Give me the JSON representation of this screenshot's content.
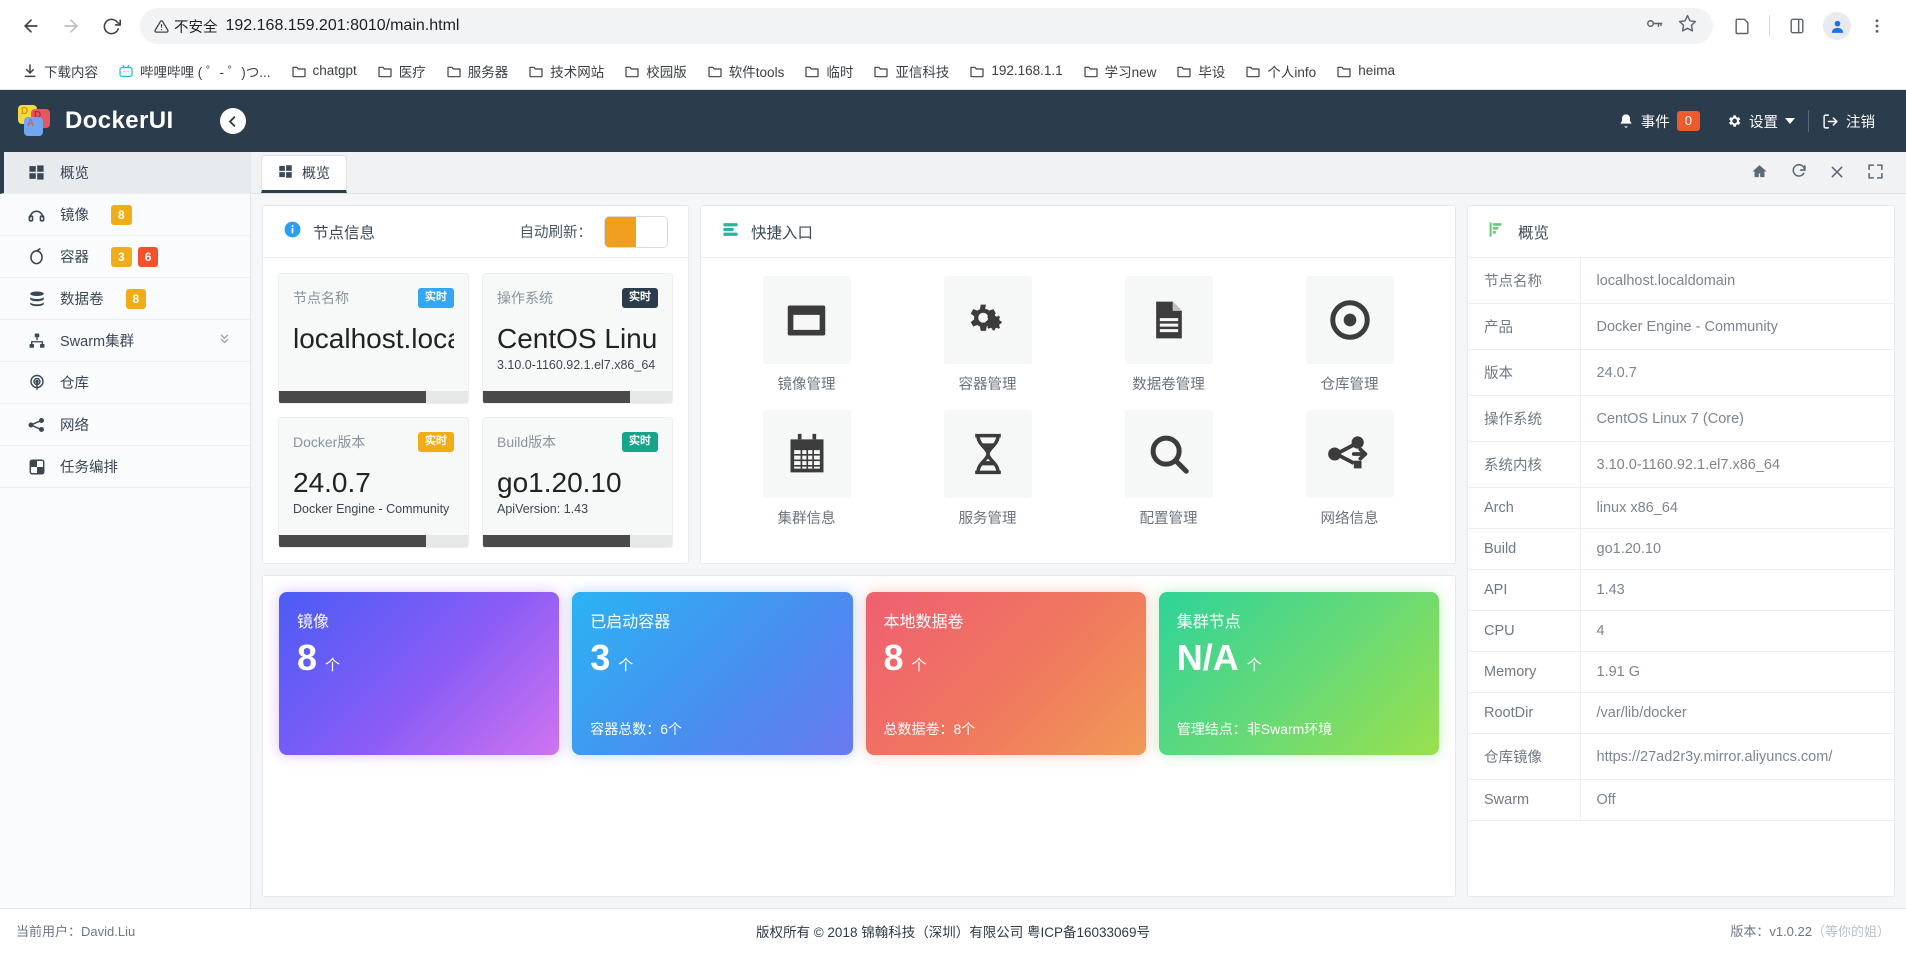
{
  "browser": {
    "back_icon": "back-arrow-icon",
    "forward_icon": "forward-arrow-icon",
    "reload_icon": "reload-icon",
    "security_label": "不安全",
    "url": "192.168.159.201:8010/main.html",
    "bookmarks": [
      {
        "label": "下载内容",
        "icon": "download-icon"
      },
      {
        "label": "哔哩哔哩 ( ゜- ゜)つ...",
        "icon": "bilibili-icon"
      },
      {
        "label": "chatgpt",
        "icon": "folder-icon"
      },
      {
        "label": "医疗",
        "icon": "folder-icon"
      },
      {
        "label": "服务器",
        "icon": "folder-icon"
      },
      {
        "label": "技术网站",
        "icon": "folder-icon"
      },
      {
        "label": "校园版",
        "icon": "folder-icon"
      },
      {
        "label": "软件tools",
        "icon": "folder-icon"
      },
      {
        "label": "临时",
        "icon": "folder-icon"
      },
      {
        "label": "亚信科技",
        "icon": "folder-icon"
      },
      {
        "label": "192.168.1.1",
        "icon": "folder-icon"
      },
      {
        "label": "学习new",
        "icon": "folder-icon"
      },
      {
        "label": "毕设",
        "icon": "folder-icon"
      },
      {
        "label": "个人info",
        "icon": "folder-icon"
      },
      {
        "label": "heima",
        "icon": "folder-icon"
      }
    ]
  },
  "header": {
    "brand": "DockerUI",
    "logo_letters": [
      "D",
      "D",
      "A"
    ],
    "collapse_icon": "chevron-left-circle-icon",
    "events_label": "事件",
    "events_count": "0",
    "settings_label": "设置",
    "logout_label": "注销",
    "accent_color": "#2b3d4d",
    "events_badge_color": "#ed5a2b"
  },
  "sidebar": {
    "items": [
      {
        "label": "概览",
        "icon": "windows-grid-icon",
        "active": true,
        "badges": []
      },
      {
        "label": "镜像",
        "icon": "image-disc-icon",
        "active": false,
        "badges": [
          {
            "text": "8",
            "color": "amber"
          }
        ]
      },
      {
        "label": "容器",
        "icon": "container-icon",
        "active": false,
        "badges": [
          {
            "text": "3",
            "color": "amber"
          },
          {
            "text": "6",
            "color": "red"
          }
        ]
      },
      {
        "label": "数据卷",
        "icon": "database-stack-icon",
        "active": false,
        "badges": [
          {
            "text": "8",
            "color": "amber"
          }
        ]
      },
      {
        "label": "Swarm集群",
        "icon": "sitemap-icon",
        "active": false,
        "badges": [],
        "caret": "chevron-double-down-icon"
      },
      {
        "label": "仓库",
        "icon": "registry-target-icon",
        "active": false,
        "badges": []
      },
      {
        "label": "网络",
        "icon": "share-network-icon",
        "active": false,
        "badges": []
      },
      {
        "label": "任务编排",
        "icon": "checkerboard-icon",
        "active": false,
        "badges": []
      }
    ]
  },
  "tabbar": {
    "tab_label": "概览",
    "tab_icon": "windows-grid-icon",
    "tools": [
      "home-icon",
      "refresh-icon",
      "close-icon",
      "fullscreen-icon"
    ]
  },
  "node_panel": {
    "title": "节点信息",
    "title_icon": "info-circle-icon",
    "auto_refresh_label": "自动刷新：",
    "toggle_on": true,
    "cards": [
      {
        "label": "节点名称",
        "badge": "实时",
        "badge_color": "#34a7f2",
        "value": "localhost.loca",
        "sub": "",
        "progress": 78
      },
      {
        "label": "操作系统",
        "badge": "实时",
        "badge_color": "#2b3d4d",
        "value": "CentOS Linux",
        "sub": "3.10.0-1160.92.1.el7.x86_64",
        "progress": 78
      },
      {
        "label": "Docker版本",
        "badge": "实时",
        "badge_color": "#f0ad18",
        "value": "24.0.7",
        "sub": "Docker Engine - Community",
        "progress": 78
      },
      {
        "label": "Build版本",
        "badge": "实时",
        "badge_color": "#17a589",
        "value": "go1.20.10",
        "sub": "ApiVersion: 1.43",
        "progress": 78
      }
    ]
  },
  "quick_panel": {
    "title": "快捷入口",
    "title_icon": "server-list-icon",
    "tiles": [
      {
        "label": "镜像管理",
        "icon": "window-frame-icon"
      },
      {
        "label": "容器管理",
        "icon": "gears-icon"
      },
      {
        "label": "数据卷管理",
        "icon": "document-icon"
      },
      {
        "label": "仓库管理",
        "icon": "bullseye-icon"
      },
      {
        "label": "集群信息",
        "icon": "calendar-grid-icon"
      },
      {
        "label": "服务管理",
        "icon": "hourglass-icon"
      },
      {
        "label": "配置管理",
        "icon": "search-icon"
      },
      {
        "label": "网络信息",
        "icon": "share-network-icon"
      }
    ]
  },
  "stats": {
    "tiles": [
      {
        "title": "镜像",
        "value": "8",
        "unit": "个",
        "footer": "",
        "theme": "t1"
      },
      {
        "title": "已启动容器",
        "value": "3",
        "unit": "个",
        "footer": "容器总数：6个",
        "theme": "t2"
      },
      {
        "title": "本地数据卷",
        "value": "8",
        "unit": "个",
        "footer": "总数据卷：8个",
        "theme": "t3"
      },
      {
        "title": "集群节点",
        "value": "N/A",
        "unit": "个",
        "footer": "管理结点：非Swarm环境",
        "theme": "t4"
      }
    ]
  },
  "overview": {
    "title": "概览",
    "title_icon": "bar-chart-icon",
    "rows": [
      {
        "key": "节点名称",
        "value": "localhost.localdomain"
      },
      {
        "key": "产品",
        "value": "Docker Engine - Community"
      },
      {
        "key": "版本",
        "value": "24.0.7"
      },
      {
        "key": "操作系统",
        "value": "CentOS Linux 7 (Core)"
      },
      {
        "key": "系统内核",
        "value": "3.10.0-1160.92.1.el7.x86_64"
      },
      {
        "key": "Arch",
        "value": "linux x86_64"
      },
      {
        "key": "Build",
        "value": "go1.20.10"
      },
      {
        "key": "API",
        "value": "1.43"
      },
      {
        "key": "CPU",
        "value": "4"
      },
      {
        "key": "Memory",
        "value": "1.91 G"
      },
      {
        "key": "RootDir",
        "value": "/var/lib/docker"
      },
      {
        "key": "仓库镜像",
        "value": "https://27ad2r3y.mirror.aliyuncs.com/"
      },
      {
        "key": "Swarm",
        "value": "Off"
      }
    ]
  },
  "footer": {
    "current_user": "当前用户：David.Liu",
    "copyright": "版权所有 © 2018 锦翰科技（深圳）有限公司 粤ICP备16033069号",
    "version": "版本：v1.0.22",
    "watermark": "（等你的姐）"
  }
}
